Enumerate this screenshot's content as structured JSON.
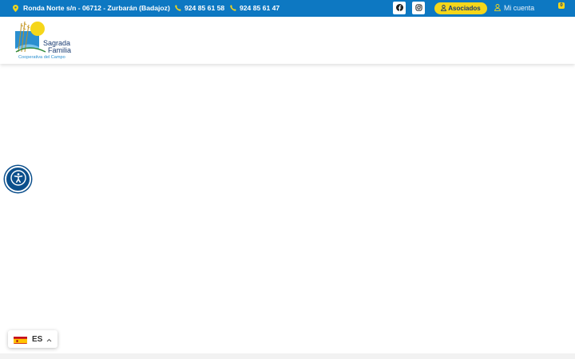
{
  "topbar": {
    "address": "Ronda Norte s/n - 06712 - Zurbarán (Badajoz)",
    "phone1": "924 85 61 58",
    "phone2": "924 85 61 47",
    "asociados_label": "Asociados",
    "account_label": "Mi cuenta",
    "cart_count": "0"
  },
  "logo": {
    "line1": "Sagrada",
    "line2": "Familia",
    "tagline": "Cooperativa del Campo"
  },
  "language": {
    "code": "ES"
  },
  "colors": {
    "topbar": "#0d78c2",
    "accent": "#f5d61a",
    "brand_dark": "#1a3c72",
    "accessibility": "#0b4f8c"
  },
  "icons": [
    "location-pin-icon",
    "phone-icon",
    "facebook-icon",
    "instagram-icon",
    "user-icon",
    "cart-icon",
    "accessibility-icon",
    "spain-flag-icon",
    "chevron-up-icon"
  ]
}
